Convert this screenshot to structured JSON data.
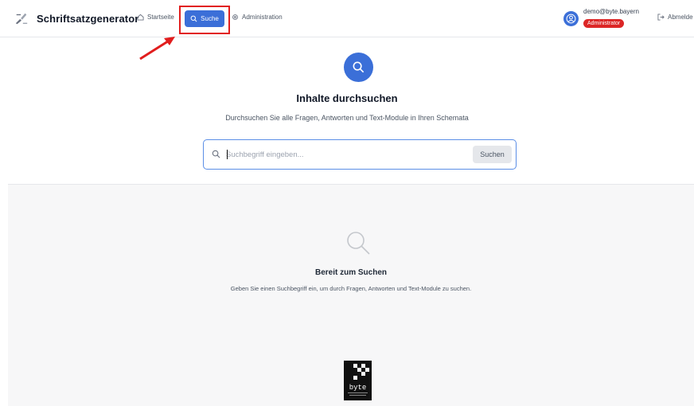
{
  "app": {
    "title": "Schriftsatzgenerator"
  },
  "nav": {
    "home": "Startseite",
    "search": "Suche",
    "admin": "Administration"
  },
  "user": {
    "email": "demo@byte.bayern",
    "role": "Administrator",
    "logout": "Abmelde"
  },
  "hero": {
    "title": "Inhalte durchsuchen",
    "subtitle": "Durchsuchen Sie alle Fragen, Antworten und Text-Module in Ihren Schemata"
  },
  "search": {
    "placeholder": "Suchbegriff eingeben...",
    "value": "",
    "button": "Suchen"
  },
  "empty_state": {
    "title": "Bereit zum Suchen",
    "text": "Geben Sie einen Suchbegriff ein, um durch Fragen, Antworten und Text-Module zu suchen."
  },
  "footer": {
    "logo_text": "byte"
  },
  "colors": {
    "accent": "#3b6fd8",
    "annotation": "#e11d1d",
    "role_badge": "#dc2626"
  },
  "icons": [
    "app-logo-icon",
    "home-icon",
    "search-icon",
    "gear-icon",
    "user-circle-icon",
    "logout-icon",
    "arrow-annotation"
  ]
}
